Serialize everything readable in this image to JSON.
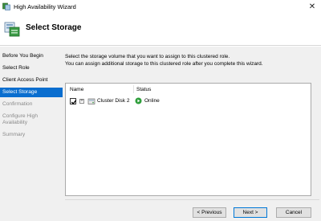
{
  "window": {
    "title": "High Availability Wizard",
    "close_glyph": "✕",
    "icon": "cluster-wizard-icon"
  },
  "header": {
    "title": "Select Storage",
    "icon": "storage-cluster-icon"
  },
  "nav": {
    "items": [
      {
        "label": "Before You Begin",
        "state": "normal"
      },
      {
        "label": "Select Role",
        "state": "normal"
      },
      {
        "label": "Client Access Point",
        "state": "normal"
      },
      {
        "label": "Select Storage",
        "state": "active"
      },
      {
        "label": "Confirmation",
        "state": "disabled"
      },
      {
        "label": "Configure High Availability",
        "state": "disabled"
      },
      {
        "label": "Summary",
        "state": "disabled"
      }
    ]
  },
  "content": {
    "line1": "Select the storage volume that you want to assign to this clustered role.",
    "line2": "You can assign additional storage to this clustered role after you complete this wizard."
  },
  "table": {
    "columns": [
      "Name",
      "Status"
    ],
    "rows": [
      {
        "name": "Cluster Disk 2",
        "status": "Online",
        "checked": true,
        "expander": "+"
      }
    ]
  },
  "buttons": {
    "previous": "< Previous",
    "next": "Next >",
    "cancel": "Cancel"
  },
  "colors": {
    "accent": "#0a6ecf",
    "status_online": "#2e9e3a"
  }
}
